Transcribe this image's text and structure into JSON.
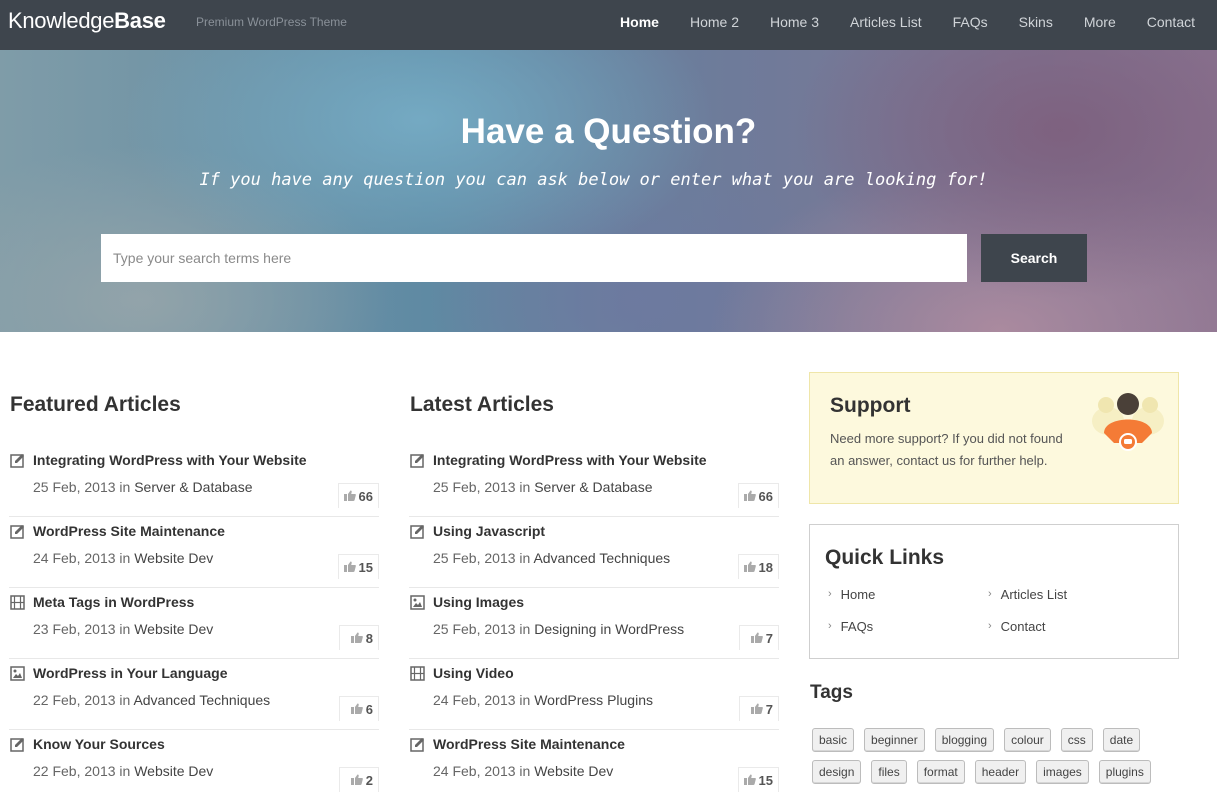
{
  "header": {
    "logo_light": "Knowledge",
    "logo_bold": "Base",
    "tagline": "Premium WordPress Theme",
    "nav": [
      "Home",
      "Home 2",
      "Home 3",
      "Articles List",
      "FAQs",
      "Skins",
      "More",
      "Contact"
    ],
    "active_nav": "Home"
  },
  "hero": {
    "title": "Have a Question?",
    "subtitle": "If you have any question you can ask below or enter what you are looking for!",
    "search_placeholder": "Type your search terms here",
    "search_button": "Search"
  },
  "featured": {
    "heading": "Featured Articles",
    "items": [
      {
        "title": "Integrating WordPress with Your Website",
        "date": "25 Feb, 2013",
        "in": "in",
        "category": "Server & Database",
        "likes": "66",
        "icon": "edit-icon"
      },
      {
        "title": "WordPress Site Maintenance",
        "date": "24 Feb, 2013",
        "in": "in",
        "category": "Website Dev",
        "likes": "15",
        "icon": "edit-icon"
      },
      {
        "title": "Meta Tags in WordPress",
        "date": "23 Feb, 2013",
        "in": "in",
        "category": "Website Dev",
        "likes": "8",
        "icon": "video-icon"
      },
      {
        "title": "WordPress in Your Language",
        "date": "22 Feb, 2013",
        "in": "in",
        "category": "Advanced Techniques",
        "likes": "6",
        "icon": "image-icon"
      },
      {
        "title": "Know Your Sources",
        "date": "22 Feb, 2013",
        "in": "in",
        "category": "Website Dev",
        "likes": "2",
        "icon": "edit-icon"
      }
    ]
  },
  "latest": {
    "heading": "Latest Articles",
    "items": [
      {
        "title": "Integrating WordPress with Your Website",
        "date": "25 Feb, 2013",
        "in": "in",
        "category": "Server & Database",
        "likes": "66",
        "icon": "edit-icon"
      },
      {
        "title": "Using Javascript",
        "date": "25 Feb, 2013",
        "in": "in",
        "category": "Advanced Techniques",
        "likes": "18",
        "icon": "edit-icon"
      },
      {
        "title": "Using Images",
        "date": "25 Feb, 2013",
        "in": "in",
        "category": "Designing in WordPress",
        "likes": "7",
        "icon": "image-icon"
      },
      {
        "title": "Using Video",
        "date": "24 Feb, 2013",
        "in": "in",
        "category": "WordPress Plugins",
        "likes": "7",
        "icon": "video-icon"
      },
      {
        "title": "WordPress Site Maintenance",
        "date": "24 Feb, 2013",
        "in": "in",
        "category": "Website Dev",
        "likes": "15",
        "icon": "edit-icon"
      }
    ]
  },
  "support": {
    "heading": "Support",
    "text": "Need more support? If you did not found an answer, contact us for further help."
  },
  "quick_links": {
    "heading": "Quick Links",
    "links": [
      "Home",
      "Articles List",
      "FAQs",
      "Contact"
    ]
  },
  "tags": {
    "heading": "Tags",
    "items": [
      "basic",
      "beginner",
      "blogging",
      "colour",
      "css",
      "date",
      "design",
      "files",
      "format",
      "header",
      "images",
      "plugins"
    ]
  },
  "colors": {
    "header_bg": "#3e454d",
    "support_bg": "#fdf9dd",
    "support_accent": "#f47b36"
  }
}
